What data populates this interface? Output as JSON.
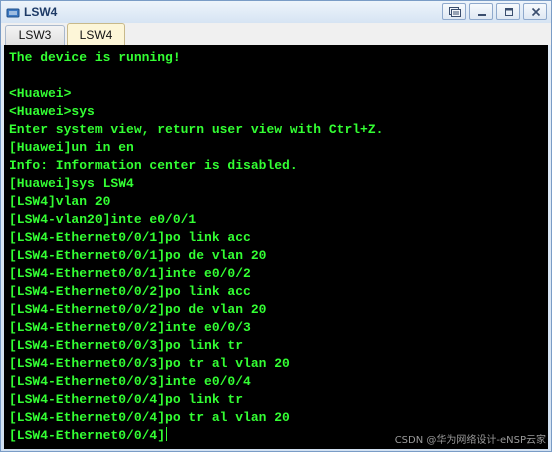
{
  "window": {
    "title": "LSW4"
  },
  "tabs": [
    {
      "label": "LSW3",
      "active": false
    },
    {
      "label": "LSW4",
      "active": true
    }
  ],
  "terminal": {
    "lines": [
      "The device is running!",
      "",
      "<Huawei>",
      "<Huawei>sys",
      "Enter system view, return user view with Ctrl+Z.",
      "[Huawei]un in en",
      "Info: Information center is disabled.",
      "[Huawei]sys LSW4",
      "[LSW4]vlan 20",
      "[LSW4-vlan20]inte e0/0/1",
      "[LSW4-Ethernet0/0/1]po link acc",
      "[LSW4-Ethernet0/0/1]po de vlan 20",
      "[LSW4-Ethernet0/0/1]inte e0/0/2",
      "[LSW4-Ethernet0/0/2]po link acc",
      "[LSW4-Ethernet0/0/2]po de vlan 20",
      "[LSW4-Ethernet0/0/2]inte e0/0/3",
      "[LSW4-Ethernet0/0/3]po link tr",
      "[LSW4-Ethernet0/0/3]po tr al vlan 20",
      "[LSW4-Ethernet0/0/3]inte e0/0/4",
      "[LSW4-Ethernet0/0/4]po link tr",
      "[LSW4-Ethernet0/0/4]po tr al vlan 20",
      "[LSW4-Ethernet0/0/4]"
    ],
    "text_color": "#33ff33",
    "background": "#000000"
  },
  "watermark": "CSDN @华为网络设计-eNSP云家",
  "icons": {
    "app": "switch-app-icon",
    "restore": "restore-icon",
    "minimize": "minimize-icon",
    "maximize": "maximize-icon",
    "close": "close-icon"
  }
}
